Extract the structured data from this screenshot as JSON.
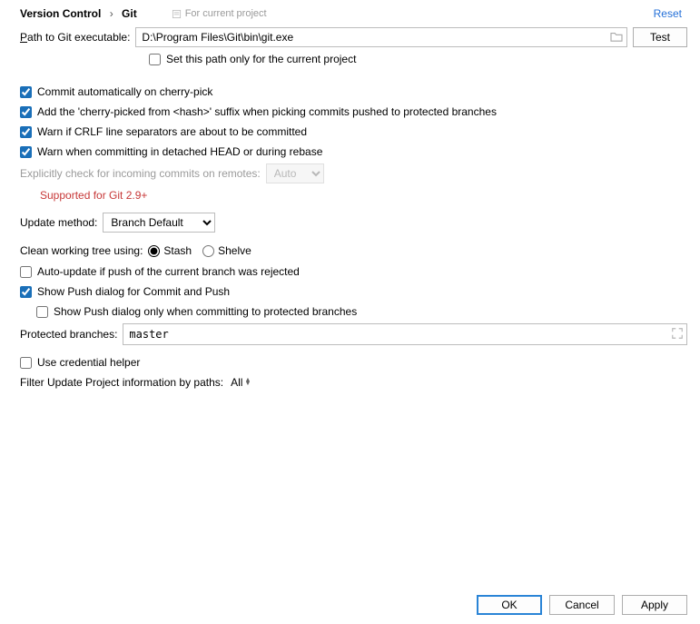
{
  "header": {
    "breadcrumb_root": "Version Control",
    "breadcrumb_leaf": "Git",
    "project_tag": "For current project",
    "reset": "Reset"
  },
  "path": {
    "label": "Path to Git executable:",
    "value": "D:\\Program Files\\Git\\bin\\git.exe",
    "test_btn": "Test"
  },
  "opts": {
    "set_path_project": "Set this path only for the current project",
    "commit_cherry": "Commit automatically on cherry-pick",
    "add_suffix": "Add the 'cherry-picked from <hash>' suffix when picking commits pushed to protected branches",
    "warn_crlf": "Warn if CRLF line separators are about to be committed",
    "warn_detached": "Warn when committing in detached HEAD or during rebase",
    "explicit_check": "Explicitly check for incoming commits on remotes:",
    "explicit_value": "Auto",
    "supported_hint": "Supported for Git 2.9+",
    "update_method_label": "Update method:",
    "update_method_value": "Branch Default",
    "clean_tree_label": "Clean working tree using:",
    "stash": "Stash",
    "shelve": "Shelve",
    "auto_update": "Auto-update if push of the current branch was rejected",
    "show_push": "Show Push dialog for Commit and Push",
    "show_push_protected": "Show Push dialog only when committing to protected branches",
    "protected_label": "Protected branches:",
    "protected_value": "master",
    "cred_helper": "Use credential helper",
    "filter_label": "Filter Update Project information by paths:",
    "filter_value": "All"
  },
  "buttons": {
    "ok": "OK",
    "cancel": "Cancel",
    "apply": "Apply"
  }
}
